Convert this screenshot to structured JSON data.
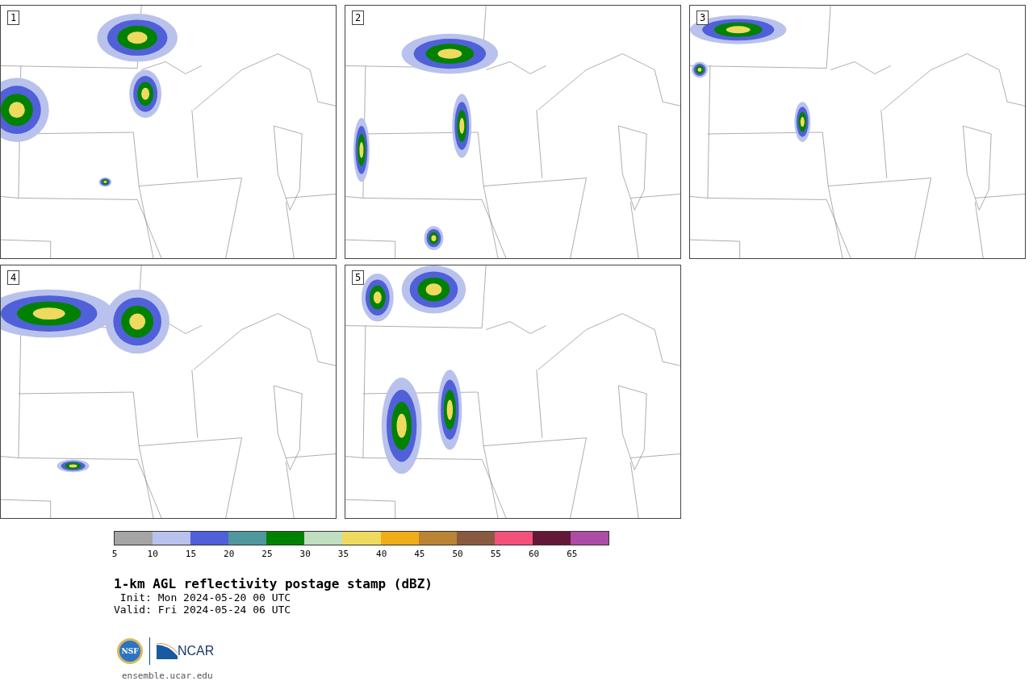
{
  "panels": [
    {
      "label": "1"
    },
    {
      "label": "2"
    },
    {
      "label": "3"
    },
    {
      "label": "4"
    },
    {
      "label": "5"
    }
  ],
  "colorbar": {
    "segments": [
      {
        "color": "#a5a5a5"
      },
      {
        "color": "#b8c2ec"
      },
      {
        "color": "#5060d8"
      },
      {
        "color": "#4f979c"
      },
      {
        "color": "#008200"
      },
      {
        "color": "#c0dec0"
      },
      {
        "color": "#efda60"
      },
      {
        "color": "#efae18"
      },
      {
        "color": "#ba8434"
      },
      {
        "color": "#8a5a40"
      },
      {
        "color": "#f4507c"
      },
      {
        "color": "#631838"
      },
      {
        "color": "#ac4ca4"
      }
    ],
    "ticks": [
      "5",
      "10",
      "15",
      "20",
      "25",
      "30",
      "35",
      "40",
      "45",
      "50",
      "55",
      "60",
      "65"
    ]
  },
  "title": "1-km AGL reflectivity postage stamp (dBZ)",
  "init": "Init: Mon 2024-05-20 00 UTC",
  "valid": "Valid: Fri 2024-05-24 06 UTC",
  "logo": {
    "seal_text": "NSF",
    "name": "NCAR"
  },
  "url": "ensemble.ucar.edu"
}
